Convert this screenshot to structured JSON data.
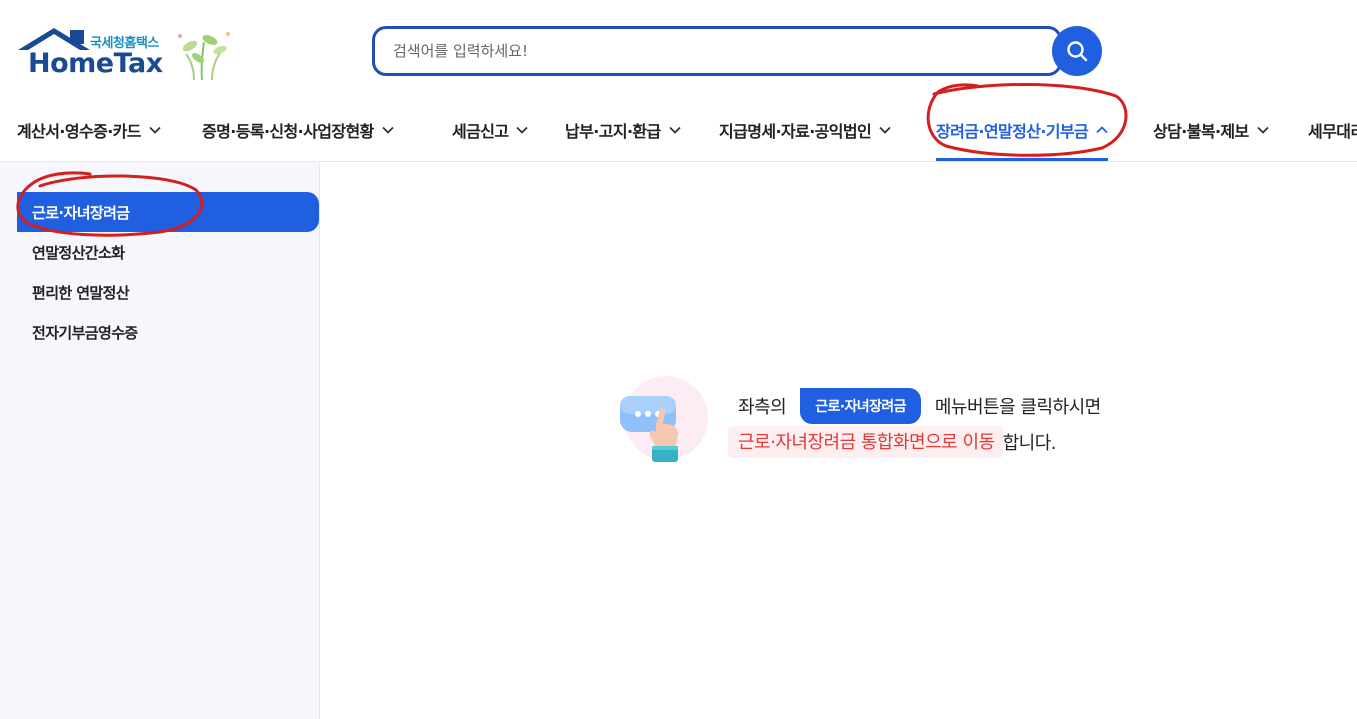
{
  "header": {
    "logo_brand": "국세청홈택스",
    "logo_text": "HomeTax",
    "search": {
      "placeholder": "검색어를 입력하세요!"
    }
  },
  "nav": {
    "items": [
      {
        "label": "계산서·영수증·카드",
        "expanded": false
      },
      {
        "label": "증명·등록·신청·사업장현황",
        "expanded": false
      },
      {
        "label": "세금신고",
        "expanded": false
      },
      {
        "label": "납부·고지·환급",
        "expanded": false
      },
      {
        "label": "지급명세·자료·공익법인",
        "expanded": false
      },
      {
        "label": "장려금·연말정산·기부금",
        "expanded": true
      },
      {
        "label": "상담·불복·제보",
        "expanded": false
      },
      {
        "label": "세무대리",
        "expanded": false
      }
    ]
  },
  "sidebar": {
    "items": [
      {
        "label": "근로·자녀장려금",
        "active": true
      },
      {
        "label": "연말정산간소화",
        "active": false
      },
      {
        "label": "편리한 연말정산",
        "active": false
      },
      {
        "label": "전자기부금영수증",
        "active": false
      }
    ]
  },
  "guide": {
    "prefix": "좌측의",
    "pill": "근로·자녀장려금",
    "suffix": "메뉴버튼을 클릭하시면",
    "highlight": "근로·자녀장려금 통합화면으로 이동",
    "end": "합니다."
  },
  "colors": {
    "accent": "#1f5fe0",
    "brand_navy": "#1a4a94",
    "highlight_red": "#e03a3a",
    "annotation_red": "#d41f1f"
  }
}
